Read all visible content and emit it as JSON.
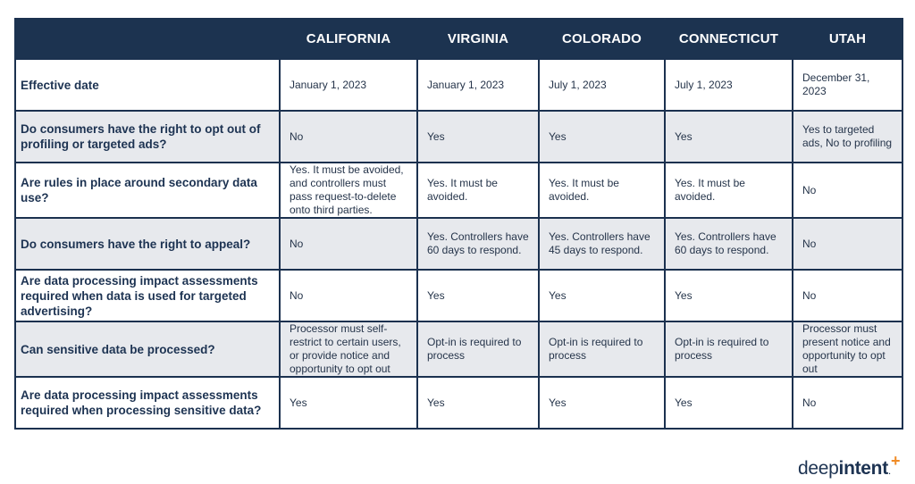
{
  "table": {
    "columns": [
      "",
      "CALIFORNIA",
      "VIRGINIA",
      "COLORADO",
      "CONNECTICUT",
      "UTAH"
    ],
    "rows": [
      {
        "question": "Effective date",
        "values": [
          "January 1, 2023",
          "January 1, 2023",
          "July 1, 2023",
          "July 1, 2023",
          "December 31, 2023"
        ]
      },
      {
        "question": "Do consumers have the right to opt out of profiling or targeted ads?",
        "values": [
          "No",
          "Yes",
          "Yes",
          "Yes",
          "Yes to targeted ads, No to profiling"
        ]
      },
      {
        "question": "Are rules in place around secondary data use?",
        "values": [
          "Yes. It must be avoided, and controllers must pass request-to-delete onto third parties.",
          "Yes. It must be avoided.",
          "Yes. It must be avoided.",
          "Yes. It must be avoided.",
          "No"
        ]
      },
      {
        "question": "Do consumers have the right to appeal?",
        "values": [
          "No",
          "Yes. Controllers have 60 days to respond.",
          "Yes. Controllers have 45 days to respond.",
          "Yes. Controllers have 60 days to respond.",
          "No"
        ]
      },
      {
        "question": "Are data processing impact assessments required when data is used for targeted advertising?",
        "values": [
          "No",
          "Yes",
          "Yes",
          "Yes",
          "No"
        ]
      },
      {
        "question": "Can sensitive data be processed?",
        "values": [
          "Processor must self-restrict to certain users, or provide notice and opportunity to opt out",
          "Opt-in is required to process",
          "Opt-in is required to process",
          "Opt-in is required to process",
          "Processor must present notice and opportunity to opt out"
        ]
      },
      {
        "question": "Are data processing impact assessments required when processing sensitive data?",
        "values": [
          "Yes",
          "Yes",
          "Yes",
          "Yes",
          "No"
        ]
      }
    ]
  },
  "logo": {
    "part1": "deep",
    "part2": "intent",
    "dot": ".",
    "plus": "+"
  },
  "colors": {
    "header_bg": "#1c3350",
    "border": "#1b314f",
    "alt_row_bg": "#e7e9ed",
    "accent": "#f08a24"
  }
}
